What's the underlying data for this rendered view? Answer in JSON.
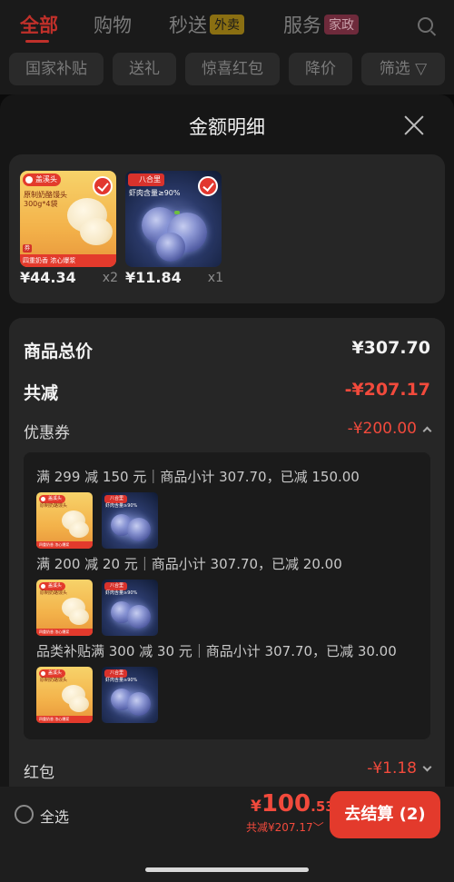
{
  "top_nav": {
    "tabs": [
      {
        "label": "全部",
        "active": true
      },
      {
        "label": "购物"
      },
      {
        "label": "秒送",
        "tag": "外卖"
      },
      {
        "label": "服务",
        "tag": "家政"
      }
    ],
    "search_icon": "search-icon"
  },
  "filters": [
    "国家补贴",
    "送礼",
    "惊喜红包",
    "降价",
    "筛选"
  ],
  "sheet": {
    "title": "金额明细",
    "close_icon": "close-icon"
  },
  "products": [
    {
      "name": "bun",
      "price": "¥44.34",
      "qty": "x2",
      "selected": true,
      "thumb": {
        "logo": "盖溪头",
        "title": "原制奶酪馒头",
        "subtitle": "300g*4袋",
        "footer": "四重奶香 浓心爆浆"
      }
    },
    {
      "name": "shrimp",
      "price": "¥11.84",
      "qty": "x1",
      "selected": true,
      "thumb": {
        "logo": "八合里",
        "title": "虾肉含量≥90%"
      }
    }
  ],
  "summary": {
    "total_label": "商品总价",
    "total_value": "¥307.70",
    "reduce_label": "共减",
    "reduce_value": "-¥207.17",
    "coupon_label": "优惠券",
    "coupon_value": "-¥200.00",
    "coupon_details": [
      "满 299 减 150 元｜商品小计 307.70，已减 150.00",
      "满 200 减 20 元｜商品小计 307.70，已减 20.00",
      "品类补贴满 300 减 30 元｜商品小计 307.70，已减 30.00"
    ],
    "redpacket_label": "红包",
    "redpacket_value": "-¥1.18"
  },
  "bottom": {
    "select_all": "全选",
    "currency": "¥",
    "total_int": "100",
    "total_dec": ".53",
    "saved": "共减¥207.17",
    "checkout": "去结算 (2)"
  },
  "colors": {
    "accent": "#e33a2c",
    "discount": "#f24a3c",
    "sheet_bg": "#161616",
    "card_bg": "#262626"
  }
}
